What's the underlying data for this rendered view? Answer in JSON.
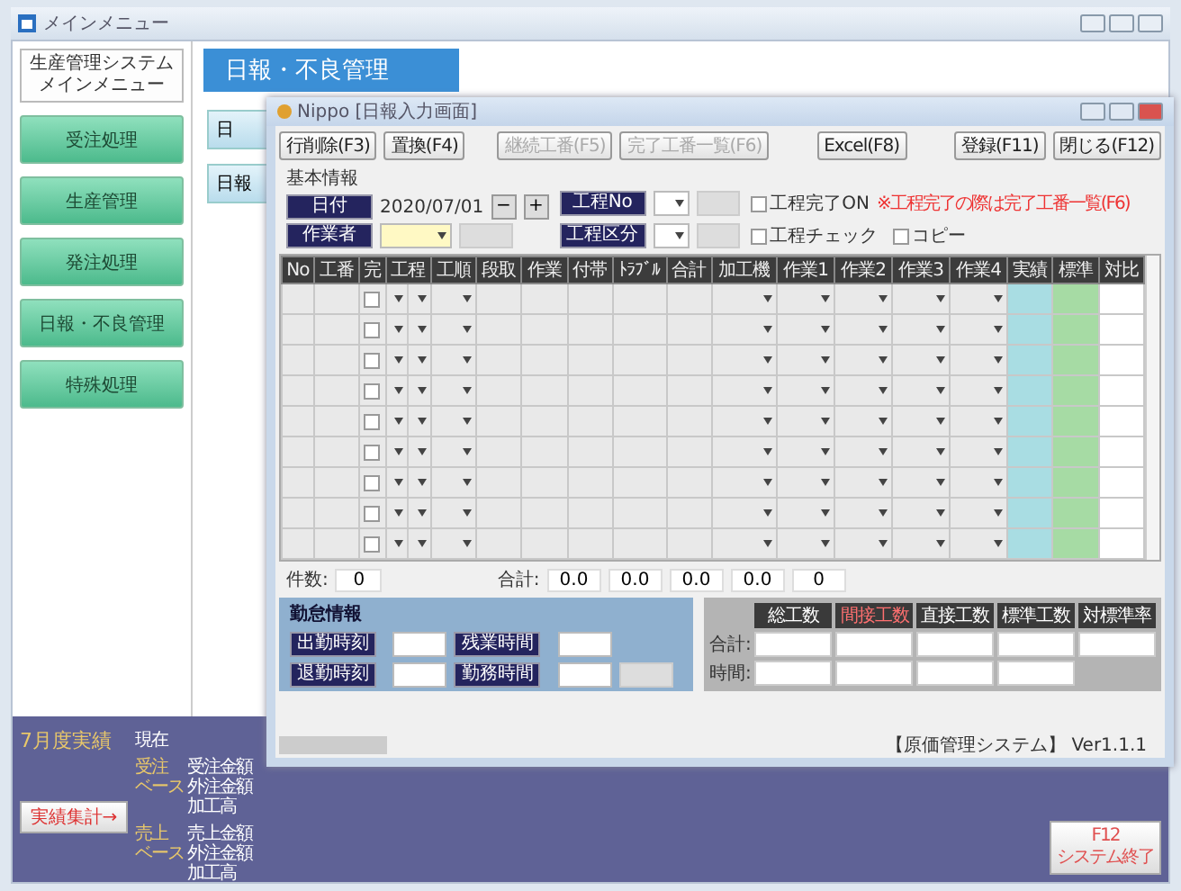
{
  "main_window": {
    "title": "メインメニュー"
  },
  "menu_header": [
    "生産管理システム",
    "メインメニュー"
  ],
  "menu_items": [
    "受注処理",
    "生産管理",
    "発注処理",
    "日報・不良管理",
    "特殊処理"
  ],
  "section_title": "日報・不良管理",
  "section_buttons": [
    "日",
    "日報"
  ],
  "results": {
    "title": "7月度実績",
    "current": "現在",
    "button": "実績集計→",
    "groups": [
      {
        "label": [
          "受注",
          "ベース"
        ],
        "items": [
          "受注金額",
          "外注金額",
          "加工高"
        ]
      },
      {
        "label": [
          "売上",
          "ベース"
        ],
        "items": [
          "売上金額",
          "外注金額",
          "加工高"
        ]
      }
    ]
  },
  "exit_button": [
    "F12",
    "システム終了"
  ],
  "dialog": {
    "title": "Nippo [日報入力画面]",
    "toolbar": {
      "left": [
        {
          "label": "行削除(F3)",
          "disabled": false
        },
        {
          "label": "置換(F4)",
          "disabled": false
        }
      ],
      "middle": [
        {
          "label": "継続工番(F5)",
          "disabled": true
        },
        {
          "label": "完了工番一覧(F6)",
          "disabled": true
        }
      ],
      "excel": [
        {
          "label": "Excel(F8)",
          "disabled": false
        }
      ],
      "right": [
        {
          "label": "登録(F11)",
          "disabled": false
        },
        {
          "label": "閉じる(F12)",
          "disabled": false
        }
      ]
    },
    "basic_info": {
      "heading": "基本情報",
      "date_label": "日付",
      "date_value": "2020/07/01",
      "minus": "−",
      "plus": "+",
      "worker_label": "作業者",
      "process_no_label": "工程No",
      "process_type_label": "工程区分"
    },
    "checkboxes": [
      {
        "label": "工程完了ON",
        "checked": false
      },
      {
        "label": "工程チェック",
        "checked": false
      },
      {
        "label": "コピー",
        "checked": false
      }
    ],
    "note": "※工程完了の際は完了工番一覧(F6)",
    "columns": [
      {
        "label": "No",
        "kind": "text"
      },
      {
        "label": "工番",
        "kind": "text"
      },
      {
        "label": "完",
        "kind": "check"
      },
      {
        "label": "工程",
        "kind": "double-select"
      },
      {
        "label": "工順",
        "kind": "select"
      },
      {
        "label": "段取",
        "kind": "text"
      },
      {
        "label": "作業",
        "kind": "text"
      },
      {
        "label": "付帯",
        "kind": "text"
      },
      {
        "label": "ﾄﾗﾌﾞﾙ",
        "kind": "text"
      },
      {
        "label": "合計",
        "kind": "text"
      },
      {
        "label": "加工機",
        "kind": "select"
      },
      {
        "label": "作業1",
        "kind": "select"
      },
      {
        "label": "作業2",
        "kind": "select"
      },
      {
        "label": "作業3",
        "kind": "select"
      },
      {
        "label": "作業4",
        "kind": "select"
      },
      {
        "label": "実績",
        "kind": "text",
        "color": "#a9dde3"
      },
      {
        "label": "標準",
        "kind": "text",
        "color": "#a6dba4"
      },
      {
        "label": "対比",
        "kind": "text",
        "color": "#ffffff"
      }
    ],
    "rows": [
      {
        "checked": false
      },
      {
        "checked": false
      },
      {
        "checked": false
      },
      {
        "checked": false
      },
      {
        "checked": false
      },
      {
        "checked": false
      },
      {
        "checked": false
      },
      {
        "checked": false
      },
      {
        "checked": false
      }
    ],
    "totals": {
      "count_label": "件数:",
      "count": "0",
      "sum_label": "合計:",
      "sums": [
        "0.0",
        "0.0",
        "0.0",
        "0.0",
        "0"
      ]
    },
    "attendance": {
      "heading": "勤怠情報",
      "fields": [
        "出勤時刻",
        "残業時間",
        "退勤時刻",
        "勤務時間"
      ]
    },
    "hours": {
      "columns": [
        {
          "label": "総工数",
          "alert": false
        },
        {
          "label": "間接工数",
          "alert": true
        },
        {
          "label": "直接工数",
          "alert": false
        },
        {
          "label": "標準工数",
          "alert": false
        },
        {
          "label": "対標準率",
          "alert": false
        }
      ],
      "row_labels": [
        "合計:",
        "時間:"
      ]
    },
    "status": "【原価管理システム】 Ver1.1.1"
  }
}
